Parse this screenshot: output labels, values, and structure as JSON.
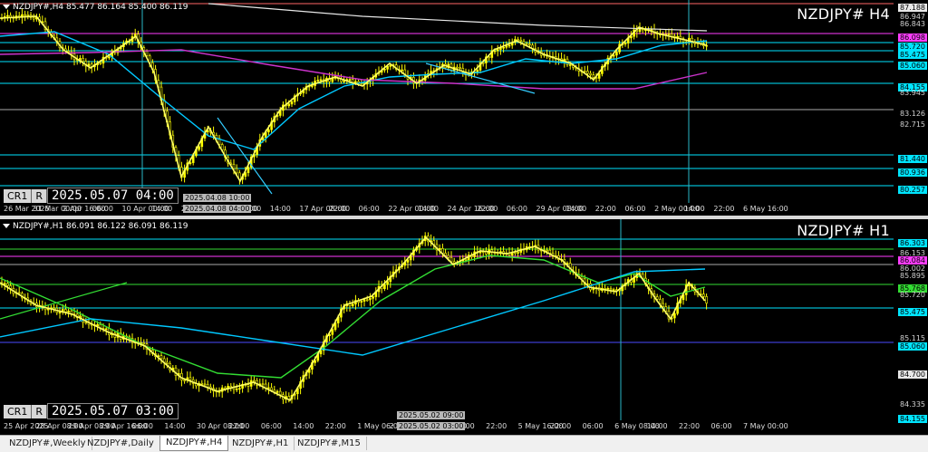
{
  "top_pane": {
    "title": "NZDJPY#,H4  85.477 86.164 85.400 86.119",
    "symbol": "NZDJPY# H4",
    "cr_label": "CR1",
    "r_label": "R",
    "datetime": "2025.05.07 04:00",
    "price_labels": [
      {
        "text": "87.188",
        "style": "white"
      },
      {
        "text": "86.947",
        "style": "grey"
      },
      {
        "text": "86.843",
        "style": "grey"
      },
      {
        "text": "86.098",
        "style": "magenta"
      },
      {
        "text": "85.720",
        "style": "cyan"
      },
      {
        "text": "85.475",
        "style": "cyan"
      },
      {
        "text": "85.060",
        "style": "cyan"
      },
      {
        "text": "84.155",
        "style": "cyan"
      },
      {
        "text": "83.945",
        "style": "grey"
      },
      {
        "text": "83.126",
        "style": "grey"
      },
      {
        "text": "82.715",
        "style": "grey"
      },
      {
        "text": "81.440",
        "style": "cyan"
      },
      {
        "text": "80.936",
        "style": "cyan"
      },
      {
        "text": "80.257",
        "style": "cyan"
      }
    ],
    "time_labels": [
      "26 Mar 2025",
      "31 Mar 00:00",
      "2 Apr 16:00",
      "06:00",
      "10 Apr 00:00",
      "14:00",
      "22:00",
      "14 Apr 16:00",
      "06:00",
      "14:00",
      "17 Apr 08:00",
      "22:00",
      "06:00",
      "22 Apr 00:00",
      "14:00",
      "24 Apr 16:00",
      "22:00",
      "06:00",
      "29 Apr 08:00",
      "14:00",
      "22:00",
      "06:00",
      "2 May 00:00",
      "14:00",
      "22:00",
      "6 May 16:00"
    ],
    "time_boxes": [
      "2025.04.08 10:00",
      "2025.04.08 04:00"
    ]
  },
  "bottom_pane": {
    "title": "NZDJPY#,H1  86.091 86.122 86.091 86.119",
    "symbol": "NZDJPY# H1",
    "cr_label": "CR1",
    "r_label": "R",
    "datetime": "2025.05.07 03:00",
    "price_labels": [
      {
        "text": "86.303",
        "style": "cyan"
      },
      {
        "text": "86.153",
        "style": "grey"
      },
      {
        "text": "86.084",
        "style": "magenta"
      },
      {
        "text": "86.002",
        "style": "grey"
      },
      {
        "text": "85.895",
        "style": "grey"
      },
      {
        "text": "85.768",
        "style": "green"
      },
      {
        "text": "85.720",
        "style": "grey"
      },
      {
        "text": "85.475",
        "style": "cyan"
      },
      {
        "text": "85.115",
        "style": "grey"
      },
      {
        "text": "85.060",
        "style": "cyan"
      },
      {
        "text": "84.700",
        "style": "white"
      },
      {
        "text": "84.335",
        "style": "grey"
      },
      {
        "text": "84.155",
        "style": "cyan"
      }
    ],
    "time_labels": [
      "25 Apr 2025",
      "28 Apr 08:00",
      "29 Apr 08:00",
      "29 Apr 16:00",
      "06:00",
      "14:00",
      "30 Apr 08:00",
      "22:00",
      "06:00",
      "14:00",
      "22:00",
      "1 May 06:00",
      "2 May 00:00",
      "5 May 00:00",
      "14:00",
      "22:00",
      "5 May 16:00",
      "22:00",
      "06:00",
      "6 May 08:00",
      "14:00",
      "22:00",
      "06:00",
      "7 May 00:00"
    ],
    "time_boxes": [
      "2025.05.02 09:00",
      "2025.05.02 03:00"
    ]
  },
  "tabs": [
    "NZDJPY#,Weekly",
    "NZDJPY#,Daily",
    "NZDJPY#,H4",
    "NZDJPY#,H1",
    "NZDJPY#,M15"
  ],
  "active_tab": "NZDJPY#,H4",
  "colors": {
    "background": "#000000",
    "candles": "#ffff00",
    "zigzag": "#ffff66",
    "ma_fast": "#33dd33",
    "ma_slow": "#00c8ff",
    "ma_long": "#cc33cc",
    "level_lines": "#00e5ff"
  }
}
